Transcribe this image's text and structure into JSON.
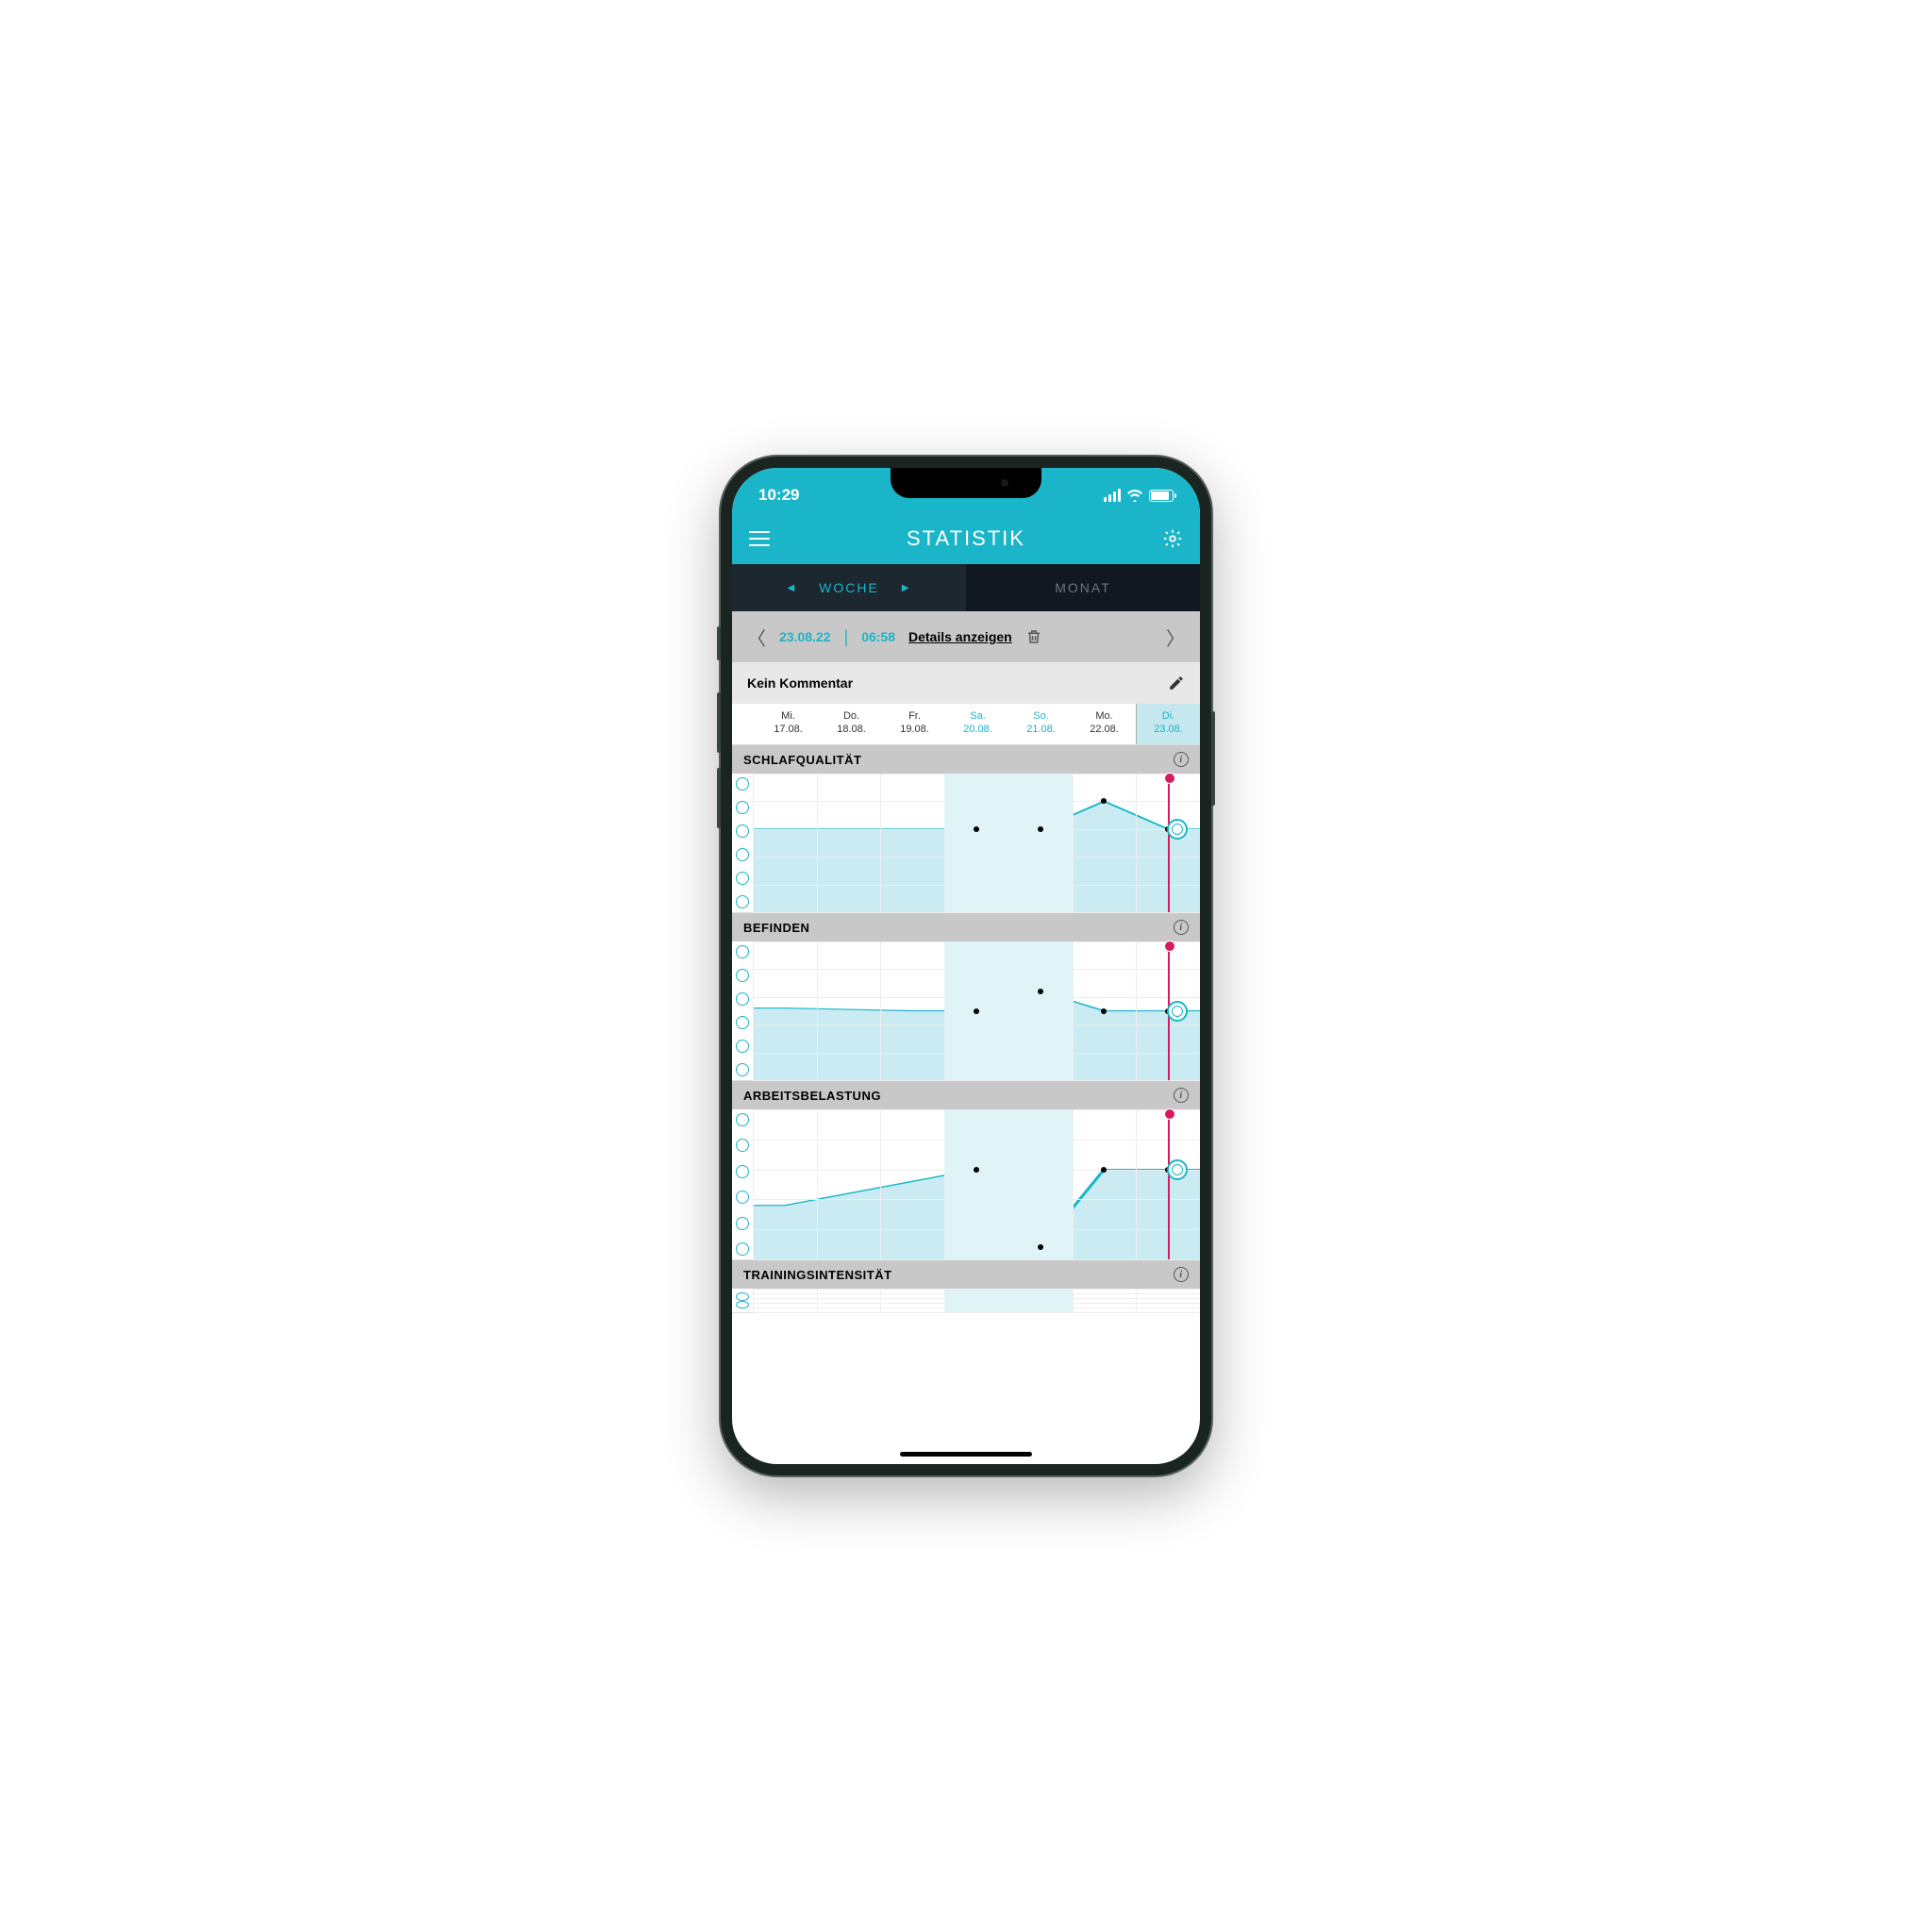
{
  "status": {
    "time": "10:29"
  },
  "header": {
    "title": "STATISTIK"
  },
  "tabs": {
    "active": "WOCHE",
    "inactive": "MONAT"
  },
  "dateNav": {
    "date": "23.08.22",
    "time": "06:58",
    "details": "Details anzeigen"
  },
  "comment": {
    "label": "Kein Kommentar"
  },
  "days": [
    {
      "name": "Mi.",
      "date": "17.08.",
      "weekend": false,
      "today": false
    },
    {
      "name": "Do.",
      "date": "18.08.",
      "weekend": false,
      "today": false
    },
    {
      "name": "Fr.",
      "date": "19.08.",
      "weekend": false,
      "today": false
    },
    {
      "name": "Sa.",
      "date": "20.08.",
      "weekend": true,
      "today": false
    },
    {
      "name": "So.",
      "date": "21.08.",
      "weekend": true,
      "today": false
    },
    {
      "name": "Mo.",
      "date": "22.08.",
      "weekend": false,
      "today": false
    },
    {
      "name": "Di.",
      "date": "23.08.",
      "weekend": false,
      "today": true
    }
  ],
  "sections": [
    {
      "title": "SCHLAFQUALITÄT"
    },
    {
      "title": "BEFINDEN"
    },
    {
      "title": "ARBEITSBELASTUNG"
    },
    {
      "title": "TRAININGSINTENSITÄT"
    }
  ],
  "colors": {
    "accent": "#1ab5c9",
    "fill": "#bfe7ee",
    "line": "#1ab5c9",
    "todayLine": "#d81b60"
  },
  "chart_data": [
    {
      "type": "line",
      "title": "SCHLAFQUALITÄT",
      "categories": [
        "Mi.",
        "Do.",
        "Fr.",
        "Sa.",
        "So.",
        "Mo.",
        "Di."
      ],
      "ylim": [
        1,
        6
      ],
      "y_scale_labels_count": 6,
      "values": [
        4,
        4,
        4,
        4,
        4,
        5,
        4
      ],
      "current_index": 6,
      "current_value": 4
    },
    {
      "type": "line",
      "title": "BEFINDEN",
      "categories": [
        "Mi.",
        "Do.",
        "Fr.",
        "Sa.",
        "So.",
        "Mo.",
        "Di."
      ],
      "ylim": [
        1,
        6
      ],
      "y_scale_labels_count": 6,
      "values": [
        3.6,
        3.55,
        3.5,
        3.5,
        4.2,
        3.5,
        3.5
      ],
      "current_index": 6,
      "current_value": 3.5
    },
    {
      "type": "line",
      "title": "ARBEITSBELASTUNG",
      "categories": [
        "Mi.",
        "Do.",
        "Fr.",
        "Sa.",
        "So.",
        "Mo.",
        "Di."
      ],
      "ylim": [
        1,
        6
      ],
      "y_scale_labels_count": 6,
      "values": [
        2.8,
        3.2,
        3.6,
        4,
        1.4,
        4,
        4
      ],
      "current_index": 6,
      "current_value": 4
    },
    {
      "type": "line",
      "title": "TRAININGSINTENSITÄT",
      "categories": [
        "Mi.",
        "Do.",
        "Fr.",
        "Sa.",
        "So.",
        "Mo.",
        "Di."
      ],
      "ylim": [
        1,
        6
      ],
      "y_scale_labels_count": 6,
      "values": [
        null,
        null,
        null,
        null,
        null,
        null,
        null
      ],
      "current_index": 6,
      "current_value": null
    }
  ]
}
